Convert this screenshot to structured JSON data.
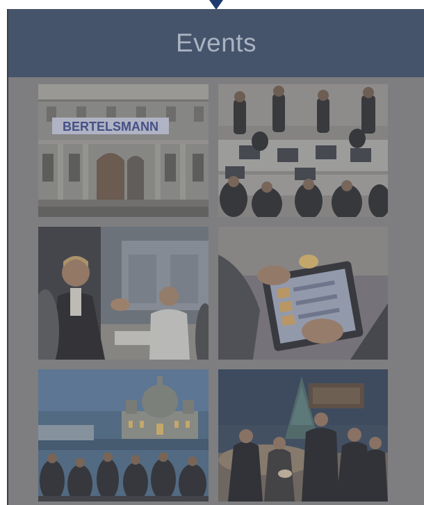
{
  "panel": {
    "title": "Events"
  },
  "gallery": {
    "items": [
      {
        "icon": "building-photo",
        "banner_text": "BERTELSMANN"
      },
      {
        "icon": "workshop-photo"
      },
      {
        "icon": "presentation-photo"
      },
      {
        "icon": "tablet-photo"
      },
      {
        "icon": "night-terrace-photo"
      },
      {
        "icon": "lounge-photo"
      }
    ]
  },
  "colors": {
    "header": "#45546b",
    "panel": "#7e7e80",
    "title_text": "#aab3c2",
    "pointer": "#1f3a6e"
  }
}
